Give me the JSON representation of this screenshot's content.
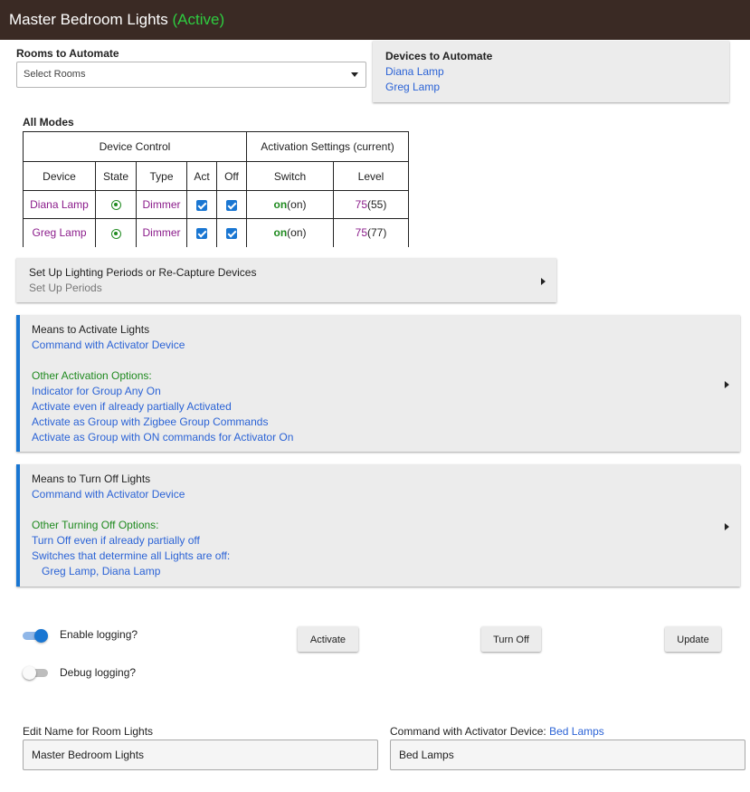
{
  "header": {
    "title": "Master Bedroom Lights",
    "status": "(Active)"
  },
  "rooms": {
    "label": "Rooms to Automate",
    "placeholder": "Select Rooms"
  },
  "devices_card": {
    "title": "Devices to Automate",
    "devices": [
      "Diana Lamp",
      "Greg Lamp"
    ]
  },
  "modes": {
    "label": "All Modes",
    "group_headers": {
      "device_control": "Device Control",
      "activation": "Activation Settings (current)"
    },
    "columns": {
      "device": "Device",
      "state": "State",
      "type": "Type",
      "act": "Act",
      "off": "Off",
      "switch": "Switch",
      "level": "Level"
    },
    "rows": [
      {
        "device": "Diana Lamp",
        "type": "Dimmer",
        "switch_on": "on",
        "switch_current": "(on)",
        "level": "75",
        "level_current": "(55)"
      },
      {
        "device": "Greg Lamp",
        "type": "Dimmer",
        "switch_on": "on",
        "switch_current": "(on)",
        "level": "75",
        "level_current": "(77)"
      }
    ]
  },
  "periods": {
    "title": "Set Up Lighting Periods or Re-Capture Devices",
    "subtitle": "Set Up Periods"
  },
  "activate": {
    "title": "Means to Activate Lights",
    "method": "Command with Activator Device",
    "options_label": "Other Activation Options:",
    "options": [
      "Indicator for Group Any On",
      "Activate even if already partially Activated",
      "Activate as Group with Zigbee Group Commands",
      "Activate as Group with ON commands for Activator On"
    ]
  },
  "turnoff": {
    "title": "Means to Turn Off Lights",
    "method": "Command with Activator Device",
    "options_label": "Other Turning Off Options:",
    "option1": "Turn Off even if already partially off",
    "switches_label": "Switches that determine all Lights are off:",
    "switches_value": "Greg Lamp, Diana Lamp"
  },
  "logging": {
    "enable_label": "Enable logging?",
    "debug_label": "Debug logging?"
  },
  "buttons": {
    "activate": "Activate",
    "turn_off": "Turn Off",
    "update": "Update"
  },
  "name_field": {
    "label": "Edit Name for Room Lights",
    "value": "Master Bedroom Lights"
  },
  "activator_field": {
    "label": "Command with Activator Device:",
    "label_value": "Bed Lamps",
    "value": "Bed Lamps"
  }
}
